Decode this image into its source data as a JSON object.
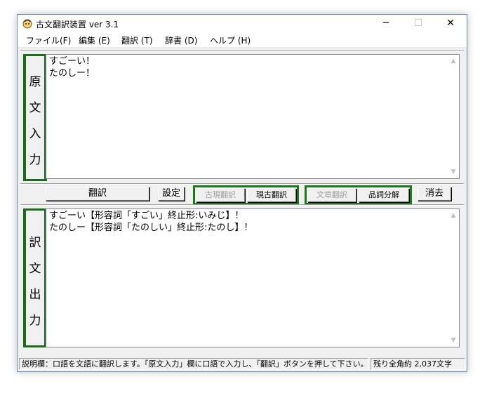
{
  "window": {
    "title": "古文翻訳装置 ver 3.1",
    "minimize": "─",
    "maximize": "☐",
    "close": "✕"
  },
  "menu": [
    "ファイル(F)",
    "編集 (E)",
    "翻訳 (T)",
    "辞書 (D)",
    "ヘルプ (H)"
  ],
  "input_panel": {
    "label_chars": [
      "原",
      "文",
      "入",
      "力"
    ],
    "text": "すごーい！\nたのしー！"
  },
  "toolbar": {
    "translate_label": "翻訳",
    "settings_label": "設定",
    "modern_to_classical_label": "古現翻訳",
    "classical_to_modern_label": "現古翻訳",
    "sentence_translate_label": "文章翻訳",
    "pos_analysis_label": "品詞分解",
    "clear_label": "消去"
  },
  "output_panel": {
    "label_chars": [
      "訳",
      "文",
      "出",
      "力"
    ],
    "text": "すごーい【形容詞「すごい」終止形:いみじ】！\nたのしー【形容詞「たのしい」終止形:たのし】！"
  },
  "status": {
    "help_text": "説明欄：口語を文語に翻訳します。「原文入力」欄に口語で入力し、「翻訳」ボタンを押して下さい。",
    "remaining_text": "残り全角約 2,037文字"
  },
  "colors": {
    "group_border": "#1a7a1a",
    "label_border": "#1a6b1a"
  }
}
